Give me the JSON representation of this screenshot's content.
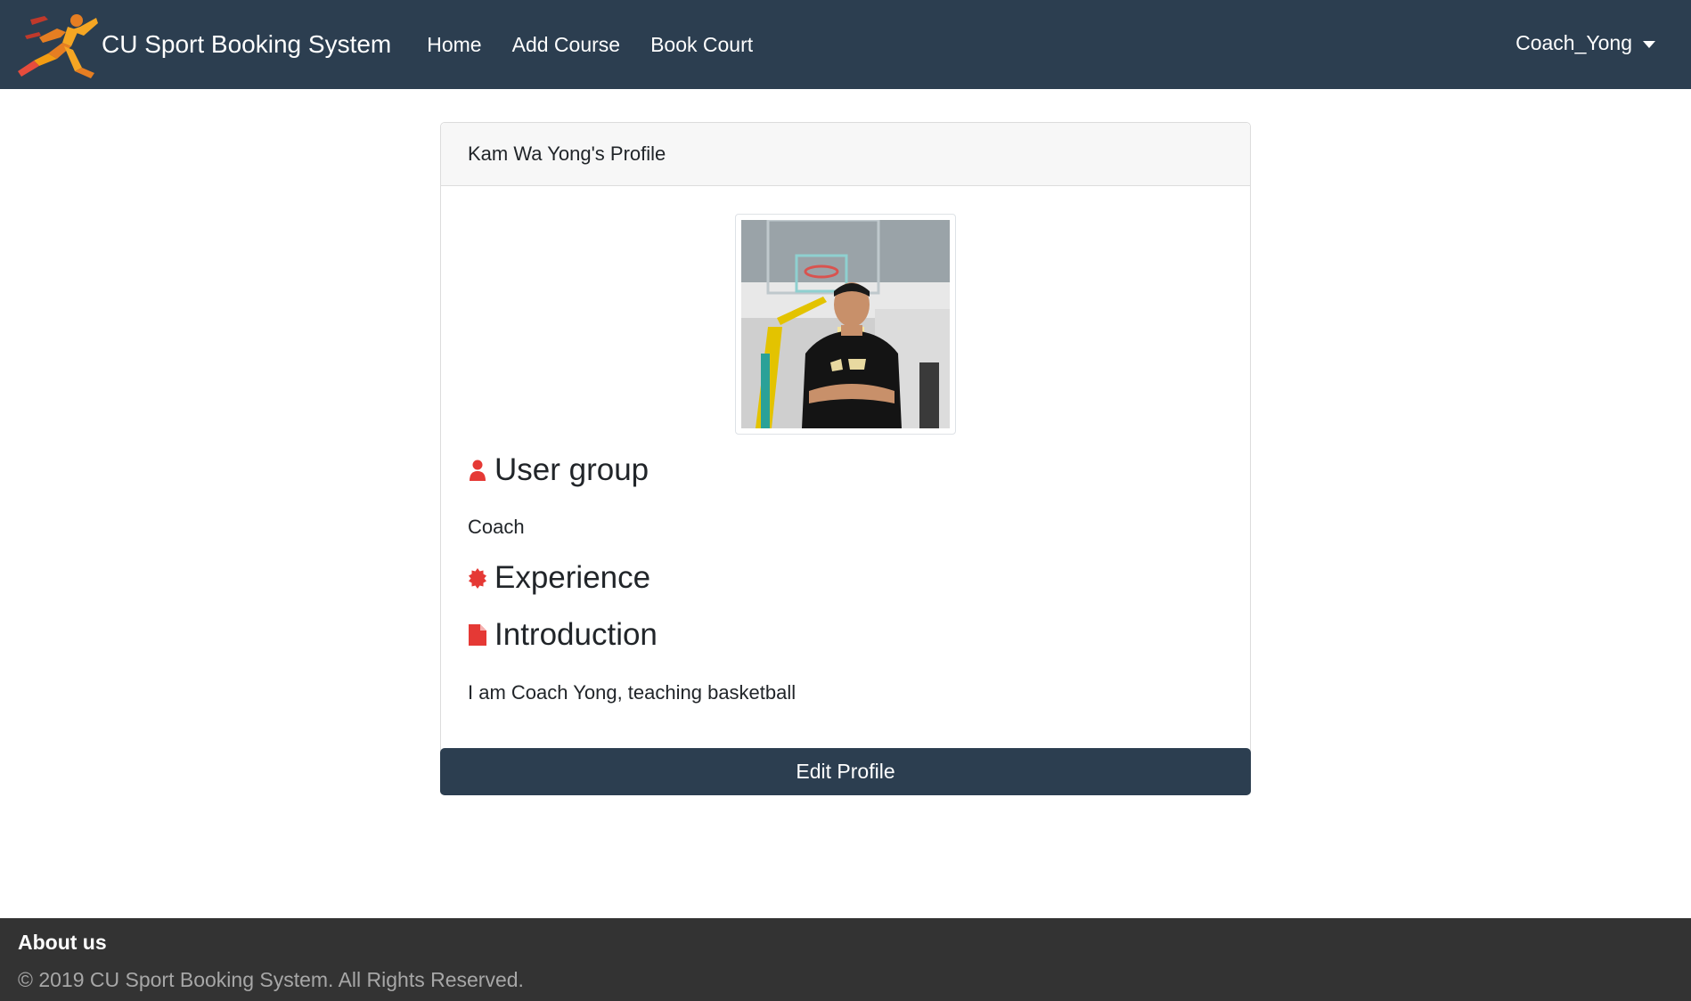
{
  "navbar": {
    "brand": "CU Sport Booking System",
    "links": [
      "Home",
      "Add Course",
      "Book Court"
    ],
    "user": "Coach_Yong",
    "bg_color": "#2c3e50"
  },
  "profile": {
    "header": "Kam Wa Yong's Profile",
    "photo_icon": "user-photo",
    "user_group_title": "User group",
    "user_group_value": "Coach",
    "experience_title": "Experience",
    "introduction_title": "Introduction",
    "introduction_value": "I am Coach Yong, teaching basketball",
    "edit_button": "Edit Profile",
    "icon_color": "#e53935"
  },
  "footer": {
    "title": "About us",
    "copyright": "© 2019 CU Sport Booking System. All Rights Reserved."
  }
}
